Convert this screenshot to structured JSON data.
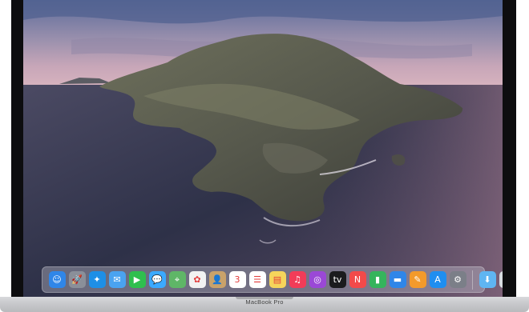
{
  "device": {
    "label": "MacBook Pro"
  },
  "dock": {
    "apps": [
      {
        "name": "finder-icon",
        "glyph": "☺",
        "bg": "#2f86e8"
      },
      {
        "name": "launchpad-icon",
        "glyph": "🚀",
        "bg": "#8a8f99"
      },
      {
        "name": "safari-icon",
        "glyph": "✦",
        "bg": "#1e8fe6"
      },
      {
        "name": "mail-icon",
        "glyph": "✉",
        "bg": "#4aa3f0"
      },
      {
        "name": "facetime-icon",
        "glyph": "▶",
        "bg": "#2fbf4e"
      },
      {
        "name": "messages-icon",
        "glyph": "💬",
        "bg": "#3ba9ff"
      },
      {
        "name": "maps-icon",
        "glyph": "⌖",
        "bg": "#5fb667"
      },
      {
        "name": "photos-icon",
        "glyph": "✿",
        "bg": "#f2f2f2"
      },
      {
        "name": "contacts-icon",
        "glyph": "👤",
        "bg": "#c9a26a"
      },
      {
        "name": "calendar-icon",
        "glyph": "3",
        "bg": "#ffffff"
      },
      {
        "name": "reminders-icon",
        "glyph": "☰",
        "bg": "#ffffff"
      },
      {
        "name": "notes-icon",
        "glyph": "▤",
        "bg": "#f6d55b"
      },
      {
        "name": "music-icon",
        "glyph": "♫",
        "bg": "#f23c58"
      },
      {
        "name": "podcasts-icon",
        "glyph": "◎",
        "bg": "#9a48d6"
      },
      {
        "name": "tv-icon",
        "glyph": "tv",
        "bg": "#1b1b1d"
      },
      {
        "name": "news-icon",
        "glyph": "N",
        "bg": "#f24a4a"
      },
      {
        "name": "numbers-icon",
        "glyph": "▮",
        "bg": "#35b45c"
      },
      {
        "name": "keynote-icon",
        "glyph": "▬",
        "bg": "#2f86e8"
      },
      {
        "name": "pages-icon",
        "glyph": "✎",
        "bg": "#f39a2b"
      },
      {
        "name": "app-store-icon",
        "glyph": "A",
        "bg": "#1f8ef0"
      },
      {
        "name": "system-preferences-icon",
        "glyph": "⚙",
        "bg": "#7b7f88"
      }
    ],
    "trailing": [
      {
        "name": "downloads-folder-icon",
        "glyph": "⬇",
        "bg": "#5fb5f2"
      },
      {
        "name": "trash-icon",
        "glyph": "🗑",
        "bg": "#d9dde2"
      }
    ]
  }
}
